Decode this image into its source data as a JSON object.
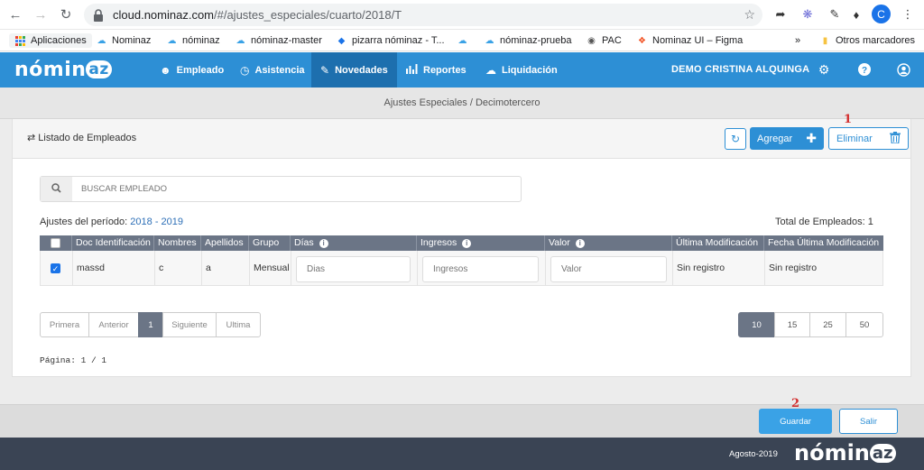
{
  "browser": {
    "url_host": "cloud.nominaz.com",
    "url_path": "/#/ajustes_especiales/cuarto/2018/T",
    "bookmarks": [
      {
        "label": "Aplicaciones",
        "icon": "apps-grid-icon"
      },
      {
        "label": "Nominaz",
        "icon": "cloud-icon"
      },
      {
        "label": "nóminaz",
        "icon": "cloud-icon"
      },
      {
        "label": "nóminaz-master",
        "icon": "cloud-icon"
      },
      {
        "label": "pizarra nóminaz - T...",
        "icon": "diamond-icon"
      },
      {
        "label": "",
        "icon": "cloud-icon"
      },
      {
        "label": "nóminaz-prueba",
        "icon": "cloud-icon"
      },
      {
        "label": "PAC",
        "icon": "globe-icon"
      },
      {
        "label": "Nominaz UI – Figma",
        "icon": "figma-icon"
      }
    ],
    "more_bookmarks": "»",
    "other_bookmarks": "Otros marcadores",
    "profile_initial": "C"
  },
  "app": {
    "logo_text": "nómin",
    "logo_badge": "az",
    "menu": [
      {
        "label": "Empleado",
        "icon": "users-icon"
      },
      {
        "label": "Asistencia",
        "icon": "clock-icon"
      },
      {
        "label": "Novedades",
        "icon": "edit-icon",
        "active": true
      },
      {
        "label": "Reportes",
        "icon": "bar-chart-icon"
      },
      {
        "label": "Liquidación",
        "icon": "cloud-upload-icon"
      }
    ],
    "user_name": "DEMO CRISTINA ALQUINGA"
  },
  "breadcrumb": "Ajustes Especiales / Decimotercero",
  "panel": {
    "title": "Listado de Empleados",
    "add_label": "Agregar",
    "delete_label": "Eliminar",
    "annotation_1": "1",
    "annotation_2": "2"
  },
  "search": {
    "placeholder": "BUSCAR EMPLEADO"
  },
  "period": {
    "label": "Ajustes del período:",
    "years": "2018 - 2019"
  },
  "total": "Total de Empleados: 1",
  "table": {
    "headers": [
      "Doc Identificación",
      "Nombres",
      "Apellidos",
      "Grupo",
      "Días",
      "Ingresos",
      "Valor",
      "Última Modificación",
      "Fecha Última Modificación"
    ],
    "row": {
      "doc": "massd",
      "nombres": "c",
      "apellidos": "a",
      "grupo": "Mensual",
      "dias_placeholder": "Dias",
      "ingresos_placeholder": "Ingresos",
      "valor_placeholder": "Valor",
      "ultima_mod": "Sin registro",
      "fecha_ultima_mod": "Sin registro",
      "checked": true
    }
  },
  "pagination": {
    "first": "Primera",
    "prev": "Anterior",
    "current": "1",
    "next": "Siguiente",
    "last": "Ultima",
    "sizes": [
      "10",
      "15",
      "25",
      "50"
    ],
    "selected_size": "10",
    "page_info": "Página: 1 / 1"
  },
  "actions": {
    "save": "Guardar",
    "exit": "Salir"
  },
  "footer": {
    "date": "Agosto-2019",
    "logo_text": "nómin",
    "logo_badge": "az"
  },
  "colors": {
    "primary": "#2d8fd5",
    "header_dark": "#3a4454",
    "table_header": "#6b7586",
    "annotation": "#d32f2f"
  }
}
